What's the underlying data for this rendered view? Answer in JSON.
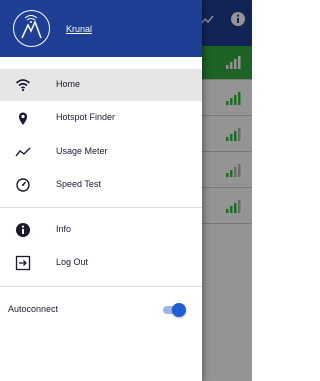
{
  "app": {
    "rows": [
      {
        "active": true,
        "signal_bars": 4
      },
      {
        "active": true,
        "signal_bars": 4
      },
      {
        "active": false,
        "signal_bars": 3
      },
      {
        "active": true,
        "signal_bars": 2
      },
      {
        "active": true,
        "signal_bars": 3
      }
    ],
    "colors": {
      "topbar": "#1e3f93",
      "active_row": "#35a943",
      "signal": "#2fbf3c"
    }
  },
  "drawer": {
    "username": "Krunal",
    "colors": {
      "header": "#1e3f93",
      "selected_bg": "#e6e6e6",
      "toggle_on": "#1e5fd6"
    },
    "menu": [
      {
        "label": "Home",
        "icon": "wifi-icon",
        "selected": true
      },
      {
        "label": "Hotspot Finder",
        "icon": "location-pin-icon",
        "selected": false
      },
      {
        "label": "Usage Meter",
        "icon": "trend-line-icon",
        "selected": false
      },
      {
        "label": "Speed Test",
        "icon": "speedometer-icon",
        "selected": false
      }
    ],
    "secondary_menu": [
      {
        "label": "Info",
        "icon": "info-icon"
      },
      {
        "label": "Log Out",
        "icon": "logout-icon"
      }
    ],
    "autoconnect": {
      "label": "Autoconnect",
      "enabled": true
    }
  }
}
